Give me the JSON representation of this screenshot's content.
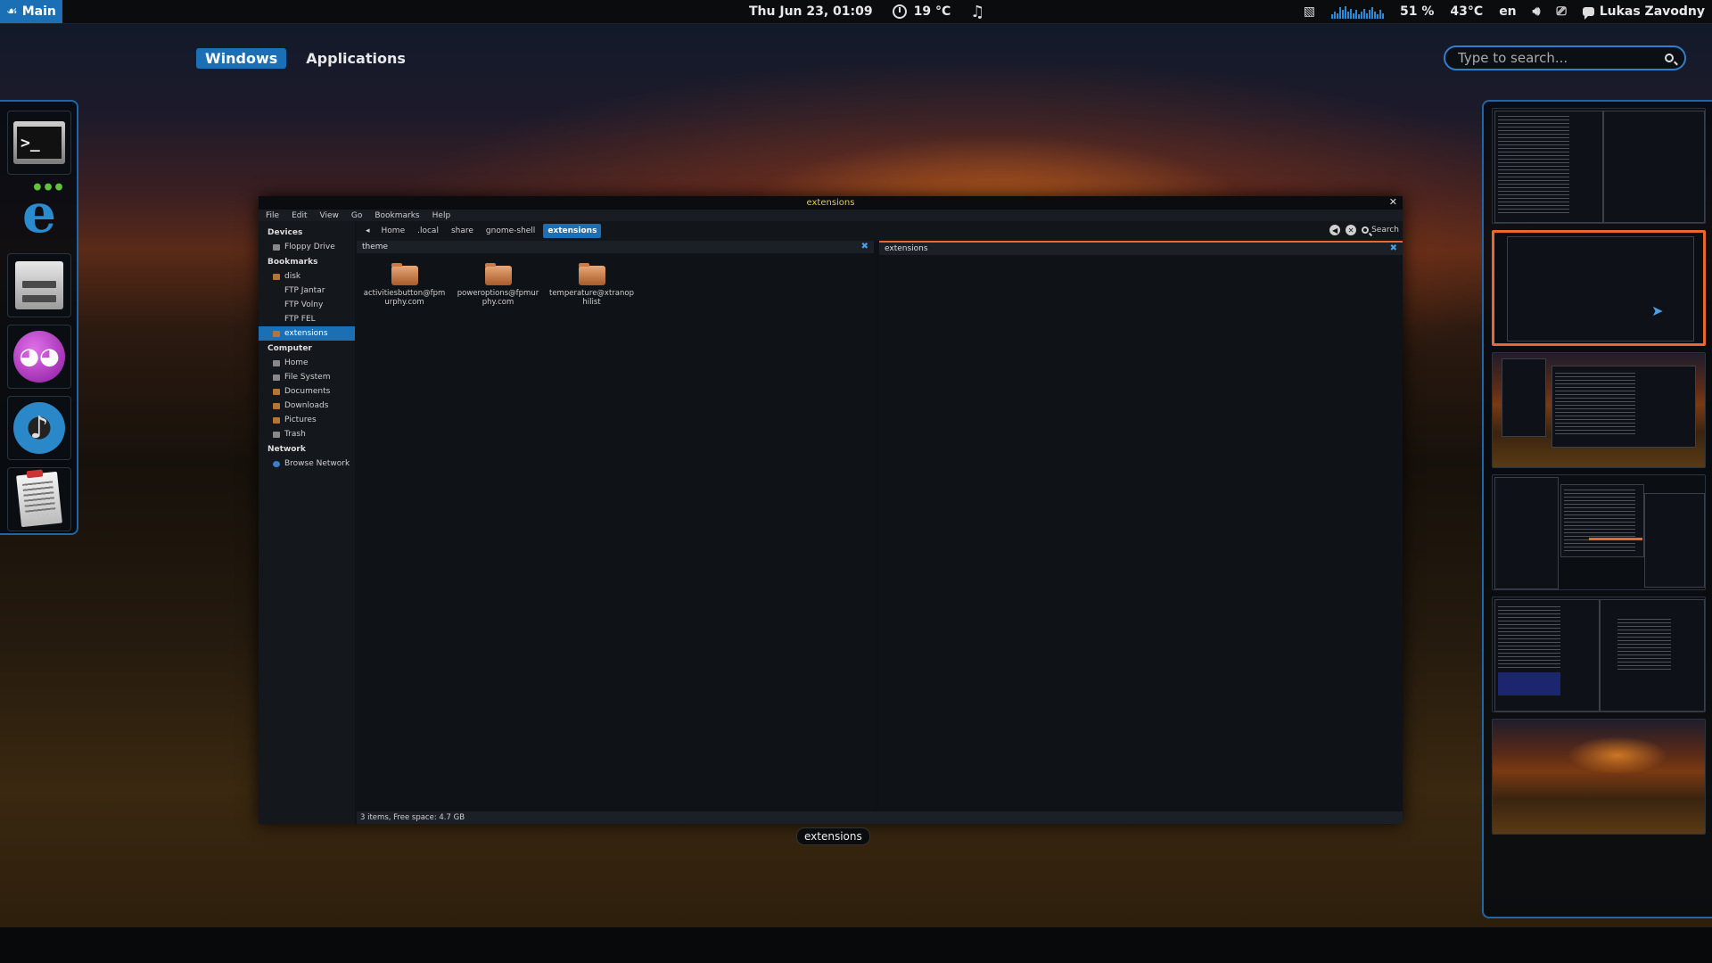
{
  "top_panel": {
    "activities_label": "Main",
    "datetime": "Thu Jun 23, 01:09",
    "weather_temp": "19 °C",
    "cpu_percent": "51 %",
    "cpu_temp": "43°C",
    "keyboard_layout": "en",
    "user_name": "Lukas Zavodny",
    "sparkline_levels": [
      0.3,
      0.5,
      0.4,
      0.8,
      0.6,
      0.9,
      0.5,
      0.7,
      0.4,
      0.6,
      0.3,
      0.5,
      0.7,
      0.4,
      0.6,
      0.8,
      0.5,
      0.3,
      0.6,
      0.4
    ]
  },
  "overview": {
    "tabs": [
      {
        "label": "Windows",
        "active": true
      },
      {
        "label": "Applications",
        "active": false
      }
    ],
    "search_placeholder": "Type to search..."
  },
  "dash": {
    "apps": [
      {
        "icon": "terminal-icon"
      },
      {
        "icon": "epiphany-browser-icon"
      },
      {
        "icon": "file-manager-icon"
      },
      {
        "icon": "empathy-chat-icon"
      },
      {
        "icon": "music-player-icon"
      },
      {
        "icon": "document-viewer-icon"
      }
    ]
  },
  "window": {
    "title": "extensions",
    "menu": [
      "File",
      "Edit",
      "View",
      "Go",
      "Bookmarks",
      "Help"
    ],
    "sidebar": {
      "devices_header": "Devices",
      "devices": [
        {
          "label": "Floppy Drive",
          "icon": "grey"
        }
      ],
      "bookmarks_header": "Bookmarks",
      "bookmarks": [
        {
          "label": "disk",
          "icon": "folder"
        },
        {
          "label": "FTP Jantar",
          "icon": "none"
        },
        {
          "label": "FTP Volny",
          "icon": "none"
        },
        {
          "label": "FTP FEL",
          "icon": "none"
        },
        {
          "label": "extensions",
          "icon": "folder",
          "active": true
        }
      ],
      "computer_header": "Computer",
      "computer": [
        {
          "label": "Home",
          "icon": "grey"
        },
        {
          "label": "File System",
          "icon": "grey"
        },
        {
          "label": "Documents",
          "icon": "folder"
        },
        {
          "label": "Downloads",
          "icon": "folder"
        },
        {
          "label": "Pictures",
          "icon": "folder"
        },
        {
          "label": "Trash",
          "icon": "grey"
        }
      ],
      "network_header": "Network",
      "network": [
        {
          "label": "Browse Network",
          "icon": "blue"
        }
      ]
    },
    "path": [
      "Home",
      ".local",
      "share",
      "gnome-shell",
      "extensions"
    ],
    "search_label": "Search",
    "left_pane_title": "theme",
    "right_pane_title": "extensions",
    "files": [
      {
        "name": "activitiesbutton@fpmurphy.com"
      },
      {
        "name": "poweroptions@fpmurphy.com"
      },
      {
        "name": "temperature@xtranophilist"
      }
    ],
    "status": "3 items, Free space: 4.7 GB",
    "caption": "extensions"
  },
  "workspaces": [
    {
      "kind": "terminals"
    },
    {
      "kind": "filemanager",
      "active": true
    },
    {
      "kind": "windows-desert"
    },
    {
      "kind": "multi"
    },
    {
      "kind": "editor"
    },
    {
      "kind": "empty-desert"
    }
  ]
}
